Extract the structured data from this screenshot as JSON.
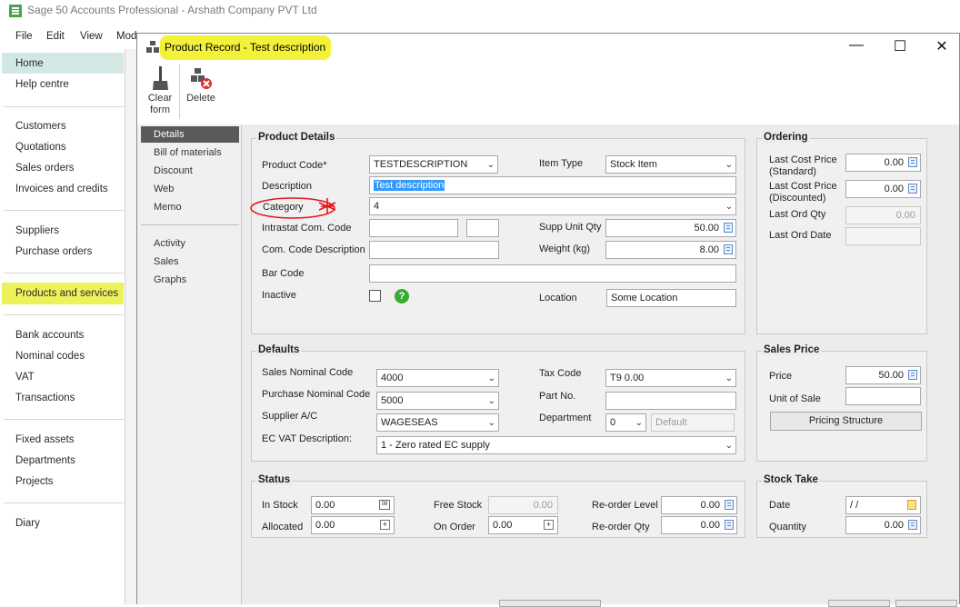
{
  "app": {
    "title": "Sage 50 Accounts Professional - Arshath Company PVT Ltd",
    "menu": [
      "File",
      "Edit",
      "View",
      "Modu"
    ]
  },
  "nav": {
    "items": [
      {
        "label": "Home"
      },
      {
        "label": "Help centre"
      },
      {
        "label": "Customers"
      },
      {
        "label": "Quotations"
      },
      {
        "label": "Sales orders"
      },
      {
        "label": "Invoices and credits"
      },
      {
        "label": "Suppliers"
      },
      {
        "label": "Purchase orders"
      },
      {
        "label": "Products and services"
      },
      {
        "label": "Bank accounts"
      },
      {
        "label": "Nominal codes"
      },
      {
        "label": "VAT"
      },
      {
        "label": "Transactions"
      },
      {
        "label": "Fixed assets"
      },
      {
        "label": "Departments"
      },
      {
        "label": "Projects"
      },
      {
        "label": "Diary"
      }
    ]
  },
  "dialog": {
    "title": "Product Record - Test description",
    "toolbar": {
      "clear_label": "Clear form",
      "delete_label": "Delete"
    },
    "tabs": [
      "Details",
      "Bill of materials",
      "Discount",
      "Web",
      "Memo",
      "Activity",
      "Sales",
      "Graphs"
    ],
    "product_details": {
      "title": "Product Details",
      "product_code_label": "Product Code*",
      "product_code": "TESTDESCRIPTION",
      "description_label": "Description",
      "description": "Test description",
      "category_label": "Category",
      "category": "4",
      "intrastat_label": "Intrastat Com. Code",
      "com_desc_label": "Com. Code Description",
      "bar_code_label": "Bar Code",
      "inactive_label": "Inactive",
      "item_type_label": "Item Type",
      "item_type": "Stock Item",
      "supp_unit_label": "Supp Unit Qty",
      "supp_unit": "50.00",
      "weight_label": "Weight (kg)",
      "weight": "8.00",
      "location_label": "Location",
      "location": "Some Location"
    },
    "ordering": {
      "title": "Ordering",
      "last_cost_std_label": "Last Cost Price (Standard)",
      "last_cost_std": "0.00",
      "last_cost_disc_label": "Last Cost Price (Discounted)",
      "last_cost_disc": "0.00",
      "last_ord_qty_label": "Last Ord Qty",
      "last_ord_qty": "0.00",
      "last_ord_date_label": "Last Ord Date"
    },
    "defaults": {
      "title": "Defaults",
      "sales_nominal_label": "Sales Nominal Code",
      "sales_nominal": "4000",
      "purchase_nominal_label": "Purchase Nominal Code",
      "purchase_nominal": "5000",
      "supplier_label": "Supplier A/C",
      "supplier": "WAGESEAS",
      "ec_vat_label": "EC VAT Description:",
      "ec_vat": "1 - Zero rated EC supply",
      "tax_code_label": "Tax Code",
      "tax_code": "T9  0.00",
      "part_no_label": "Part No.",
      "department_label": "Department",
      "department": "0",
      "department_name": "Default"
    },
    "sales_price": {
      "title": "Sales Price",
      "price_label": "Price",
      "price": "50.00",
      "unit_label": "Unit of Sale",
      "pricing_button": "Pricing Structure"
    },
    "status": {
      "title": "Status",
      "in_stock_label": "In Stock",
      "in_stock": "0.00",
      "allocated_label": "Allocated",
      "allocated": "0.00",
      "free_stock_label": "Free Stock",
      "free_stock": "0.00",
      "on_order_label": "On Order",
      "on_order": "0.00",
      "reorder_level_label": "Re-order Level",
      "reorder_level": "0.00",
      "reorder_qty_label": "Re-order Qty",
      "reorder_qty": "0.00"
    },
    "stock_take": {
      "title": "Stock Take",
      "date_label": "Date",
      "date": " / /",
      "quantity_label": "Quantity",
      "quantity": "0.00"
    }
  },
  "colors": {
    "highlight": "#f3f23a",
    "active_tab": "#5a5a5a",
    "annotation": "#e8141c",
    "help": "#3aaa35"
  }
}
